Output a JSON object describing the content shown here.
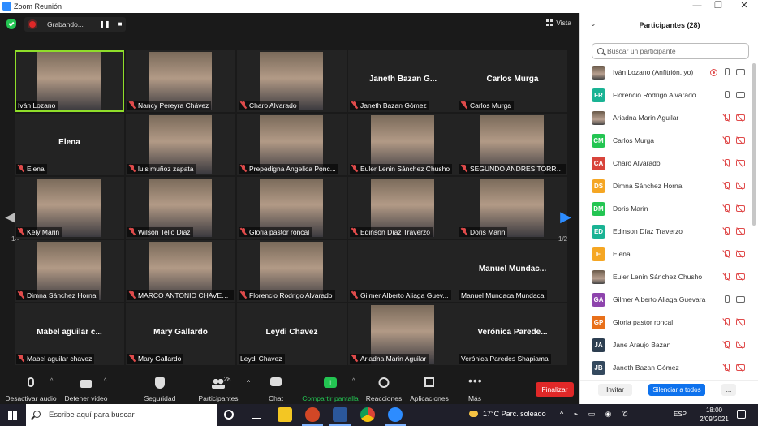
{
  "window": {
    "title": "Zoom Reunión",
    "minimize": "—",
    "restore": "❐",
    "close": "✕"
  },
  "recording": {
    "label": "Grabando...",
    "pause": "❚❚",
    "stop": "■"
  },
  "view": {
    "label": "Vista"
  },
  "paging": {
    "current": "1/2",
    "prev": "◀",
    "next": "▶"
  },
  "tiles": [
    {
      "name": "Iván Lozano",
      "video": true,
      "active": true,
      "muted": false
    },
    {
      "name": "Nancy Pereyra Chávez",
      "video": true,
      "muted": true
    },
    {
      "name": "Charo Alvarado",
      "video": true,
      "muted": true
    },
    {
      "name": "Janeth Bazan Gómez",
      "display": "Janeth Bazan G...",
      "video": false,
      "muted": true
    },
    {
      "name": "Carlos Murga",
      "display": "Carlos Murga",
      "video": false,
      "muted": true
    },
    {
      "name": "Elena",
      "display": "Elena",
      "video": false,
      "muted": true
    },
    {
      "name": "luis muñoz zapata",
      "video": true,
      "muted": true
    },
    {
      "name": "Prepedigna Angelica Ponc...",
      "video": true,
      "muted": true
    },
    {
      "name": "Euler Lenin Sánchez Chusho",
      "video": true,
      "muted": true
    },
    {
      "name": "SEGUNDO ANDRES TORRE...",
      "video": true,
      "muted": true
    },
    {
      "name": "Kely Marin",
      "video": true,
      "muted": true
    },
    {
      "name": "Wilson Tello Diaz",
      "video": true,
      "muted": true
    },
    {
      "name": "Gloria pastor roncal",
      "video": true,
      "muted": true
    },
    {
      "name": "Edinson Díaz Traverzo",
      "video": true,
      "muted": true
    },
    {
      "name": "Doris Marin",
      "video": true,
      "muted": true
    },
    {
      "name": "Dimna Sánchez Horna",
      "video": true,
      "muted": true
    },
    {
      "name": "MARCO ANTONIO CHAVEZ...",
      "video": true,
      "muted": true
    },
    {
      "name": "Florencio Rodrigo Alvarado",
      "video": true,
      "muted": true
    },
    {
      "name": "Gilmer Alberto Aliaga Guev...",
      "video": false,
      "muted": true
    },
    {
      "name": "Manuel Mundaca Mundaca",
      "display": "Manuel Mundac...",
      "video": false,
      "muted": false
    },
    {
      "name": "Mabel aguilar chavez",
      "display": "Mabel aguilar c...",
      "video": false,
      "muted": true
    },
    {
      "name": "Mary Gallardo",
      "display": "Mary Gallardo",
      "video": false,
      "muted": true
    },
    {
      "name": "Leydi Chavez",
      "display": "Leydi Chavez",
      "video": false,
      "muted": false
    },
    {
      "name": "Ariadna Marin Aguilar",
      "video": true,
      "muted": true
    },
    {
      "name": "Verónica Paredes Shapiama",
      "display": "Verónica Parede...",
      "video": false,
      "muted": false
    }
  ],
  "toolbar": {
    "mute": "Desactivar audio",
    "video": "Detener video",
    "security": "Seguridad",
    "participants": "Participantes",
    "participants_count": "28",
    "chat": "Chat",
    "share": "Compartir pantalla",
    "reactions": "Reacciones",
    "apps": "Aplicaciones",
    "more": "Más",
    "more_glyph": "•••",
    "caret": "^",
    "end": "Finalizar"
  },
  "panel": {
    "title": "Participantes (28)",
    "collapse": "⌄",
    "search_placeholder": "Buscar un participante",
    "invite": "Invitar",
    "mute_all": "Silenciar a todos",
    "more": "...",
    "participants": [
      {
        "name": "Iván Lozano (Anfitrión, yo)",
        "initials": "",
        "color": "",
        "photo": true,
        "mic": "on",
        "cam": "on",
        "rec": true
      },
      {
        "name": "Florencio Rodrigo Alvarado",
        "initials": "FR",
        "color": "#1ab394",
        "mic": "on",
        "cam": "on"
      },
      {
        "name": "Ariadna Marin Aguilar",
        "initials": "",
        "color": "",
        "photo": true,
        "mic": "off",
        "cam": "off"
      },
      {
        "name": "Carlos Murga",
        "initials": "CM",
        "color": "#23c552",
        "mic": "off",
        "cam": "off"
      },
      {
        "name": "Charo Alvarado",
        "initials": "CA",
        "color": "#d8443b",
        "mic": "off",
        "cam": "off"
      },
      {
        "name": "Dimna Sánchez Horna",
        "initials": "DS",
        "color": "#f5a623",
        "mic": "off",
        "cam": "off"
      },
      {
        "name": "Doris Marin",
        "initials": "DM",
        "color": "#23c552",
        "mic": "off",
        "cam": "off"
      },
      {
        "name": "Edinson Díaz Traverzo",
        "initials": "ED",
        "color": "#1ab394",
        "mic": "off",
        "cam": "off"
      },
      {
        "name": "Elena",
        "initials": "E",
        "color": "#f5a623",
        "mic": "off",
        "cam": "off"
      },
      {
        "name": "Euler Lenin Sánchez Chusho",
        "initials": "",
        "color": "",
        "photo": true,
        "mic": "off",
        "cam": "off"
      },
      {
        "name": "Gilmer Alberto Aliaga Guevara",
        "initials": "GA",
        "color": "#8e44ad",
        "mic": "on",
        "cam": "on"
      },
      {
        "name": "Gloria pastor roncal",
        "initials": "GP",
        "color": "#e8701a",
        "mic": "off",
        "cam": "off"
      },
      {
        "name": "Jane Araujo Bazan",
        "initials": "JA",
        "color": "#2c3e50",
        "mic": "off",
        "cam": "off"
      },
      {
        "name": "Janeth Bazan Gómez",
        "initials": "JB",
        "color": "#34495e",
        "mic": "off",
        "cam": "off"
      }
    ]
  },
  "taskbar": {
    "search_placeholder": "Escribe aquí para buscar",
    "weather": "17°C  Parc. soleado",
    "tray": "^ ⌁ ▭ ◉ ✆",
    "lang": "ESP",
    "time": "18:00",
    "date": "2/09/2021"
  },
  "colors": {
    "accent": "#2d8cff",
    "active_speaker": "#8fde2a",
    "end_red": "#e02828",
    "share_green": "#23c552",
    "muted_red": "#e04b4b"
  }
}
